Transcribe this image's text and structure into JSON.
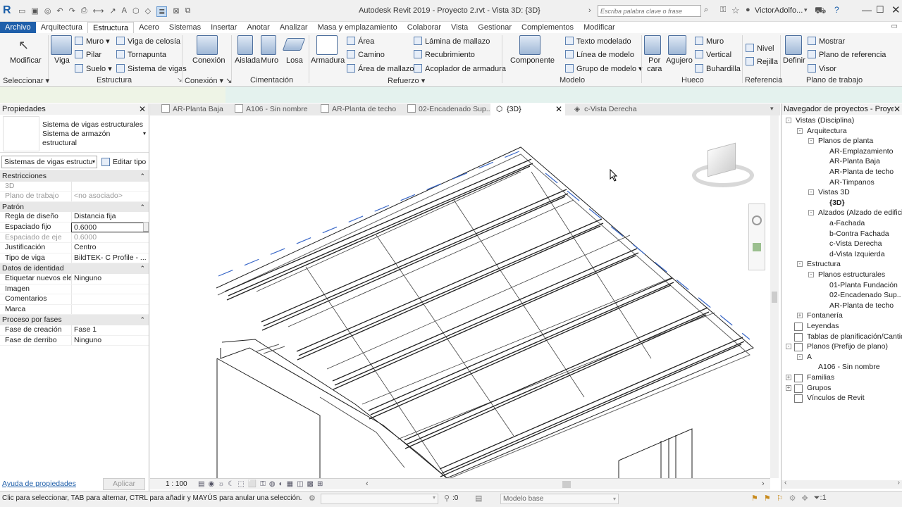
{
  "titlebar": {
    "title": "Autodesk Revit 2019 - Proyecto 2.rvt - Vista 3D: {3D}",
    "search_placeholder": "Escriba palabra clave o frase",
    "user": "VictorAdolfo..."
  },
  "menu": {
    "file": "Archivo",
    "tabs": [
      "Arquitectura",
      "Estructura",
      "Acero",
      "Sistemas",
      "Insertar",
      "Anotar",
      "Analizar",
      "Masa y emplazamiento",
      "Colaborar",
      "Vista",
      "Gestionar",
      "Complementos",
      "Modificar"
    ]
  },
  "ribbon": {
    "modificar": "Modificar",
    "viga": "Viga",
    "muro": "Muro",
    "pilar": "Pilar",
    "suelo": "Suelo",
    "viga_celosia": "Viga de celosía",
    "tornapunta": "Tornapunta",
    "sistema_vigas": "Sistema de vigas",
    "conexion": "Conexión",
    "aislada": "Aislada",
    "muro2": "Muro",
    "losa": "Losa",
    "armadura": "Armadura",
    "area": "Área",
    "camino": "Camino",
    "area_mallazo": "Área de mallazo",
    "lamina_mallazo": "Lámina de mallazo",
    "recubrimiento": "Recubrimiento",
    "acoplador": "Acoplador de armadura",
    "componente": "Componente",
    "texto_modelado": "Texto modelado",
    "linea_modelo": "Línea de modelo",
    "grupo_modelo": "Grupo de modelo",
    "por_cara": "Por\ncara",
    "agujero": "Agujero",
    "muro3": "Muro",
    "vertical": "Vertical",
    "buhardilla": "Buhardilla",
    "nivel": "Nivel",
    "rejilla": "Rejilla",
    "definir": "Definir",
    "mostrar": "Mostrar",
    "plano_ref": "Plano de referencia",
    "visor": "Visor",
    "panels": {
      "seleccionar": "Seleccionar",
      "estructura": "Estructura",
      "conexion": "Conexión",
      "cimentacion": "Cimentación",
      "refuerzo": "Refuerzo",
      "modelo": "Modelo",
      "hueco": "Hueco",
      "referencia": "Referencia",
      "plano_trabajo": "Plano de trabajo"
    }
  },
  "properties": {
    "title": "Propiedades",
    "type_line1": "Sistema de vigas estructurales",
    "type_line2": "Sistema de armazón estructural",
    "selector": "Sistemas de vigas estructura",
    "edit_type": "Editar tipo",
    "sections": [
      {
        "name": "Restricciones",
        "rows": [
          {
            "k": "3D",
            "v": "",
            "grey": true
          },
          {
            "k": "Plano de trabajo",
            "v": "<no asociado>",
            "grey": true
          }
        ]
      },
      {
        "name": "Patrón",
        "rows": [
          {
            "k": "Regla de diseño",
            "v": "Distancia fija"
          },
          {
            "k": "Espaciado fijo",
            "v": "0.6000"
          },
          {
            "k": "Espaciado de eje",
            "v": "0.6000",
            "grey": true
          },
          {
            "k": "Justificación",
            "v": "Centro"
          },
          {
            "k": "Tipo de viga",
            "v": "BildTEK- C Profile - ..."
          }
        ]
      },
      {
        "name": "Datos de identidad",
        "rows": [
          {
            "k": "Etiquetar nuevos ele...",
            "v": "Ninguno"
          },
          {
            "k": "Imagen",
            "v": ""
          },
          {
            "k": "Comentarios",
            "v": ""
          },
          {
            "k": "Marca",
            "v": ""
          }
        ]
      },
      {
        "name": "Proceso por fases",
        "rows": [
          {
            "k": "Fase de creación",
            "v": "Fase 1"
          },
          {
            "k": "Fase de derribo",
            "v": "Ninguno"
          }
        ]
      }
    ],
    "help_link": "Ayuda de propiedades",
    "apply": "Aplicar"
  },
  "viewtabs": [
    "AR-Planta Baja",
    "A106 - Sin nombre",
    "AR-Planta de techo",
    "02-Encadenado Sup..",
    "{3D}",
    "c-Vista Derecha"
  ],
  "viewbar": {
    "scale": "1 : 100"
  },
  "browser": {
    "title": "Navegador de proyectos - Proyec...",
    "nodes": [
      {
        "t": "Vistas (Disciplina)",
        "lvl": 0,
        "exp": "-"
      },
      {
        "t": "Arquitectura",
        "lvl": 1,
        "exp": "-"
      },
      {
        "t": "Planos de planta",
        "lvl": 2,
        "exp": "-"
      },
      {
        "t": "AR-Emplazamiento",
        "lvl": 3
      },
      {
        "t": "AR-Planta Baja",
        "lvl": 3
      },
      {
        "t": "AR-Planta de techo",
        "lvl": 3
      },
      {
        "t": "AR-Timpanos",
        "lvl": 3
      },
      {
        "t": "Vistas 3D",
        "lvl": 2,
        "exp": "-"
      },
      {
        "t": "{3D}",
        "lvl": 3,
        "bold": true
      },
      {
        "t": "Alzados (Alzado de edificio)",
        "lvl": 2,
        "exp": "-"
      },
      {
        "t": "a-Fachada",
        "lvl": 3
      },
      {
        "t": "b-Contra Fachada",
        "lvl": 3
      },
      {
        "t": "c-Vista Derecha",
        "lvl": 3
      },
      {
        "t": "d-Vista Izquierda",
        "lvl": 3
      },
      {
        "t": "Estructura",
        "lvl": 1,
        "exp": "-"
      },
      {
        "t": "Planos estructurales",
        "lvl": 2,
        "exp": "-"
      },
      {
        "t": "01-Planta  Fundación",
        "lvl": 3
      },
      {
        "t": "02-Encadenado Sup..",
        "lvl": 3
      },
      {
        "t": "AR-Planta de techo",
        "lvl": 3
      },
      {
        "t": "Fontanería",
        "lvl": 1,
        "exp": "+"
      },
      {
        "t": "Leyendas",
        "lvl": 0,
        "icon": true
      },
      {
        "t": "Tablas de planificación/Cantidades",
        "lvl": 0,
        "icon": true
      },
      {
        "t": "Planos (Prefijo de plano)",
        "lvl": 0,
        "exp": "-",
        "icon": true
      },
      {
        "t": "A",
        "lvl": 1,
        "exp": "-"
      },
      {
        "t": "A106 - Sin nombre",
        "lvl": 2
      },
      {
        "t": "Familias",
        "lvl": 0,
        "exp": "+",
        "icon": true
      },
      {
        "t": "Grupos",
        "lvl": 0,
        "exp": "+",
        "icon": true
      },
      {
        "t": "Vínculos de Revit",
        "lvl": 0,
        "icon": true
      }
    ]
  },
  "status": {
    "hint": "Clic para seleccionar, TAB para alternar, CTRL para añadir y MAYÚS para anular una selección.",
    "count": ":0",
    "model": "Modelo base"
  }
}
